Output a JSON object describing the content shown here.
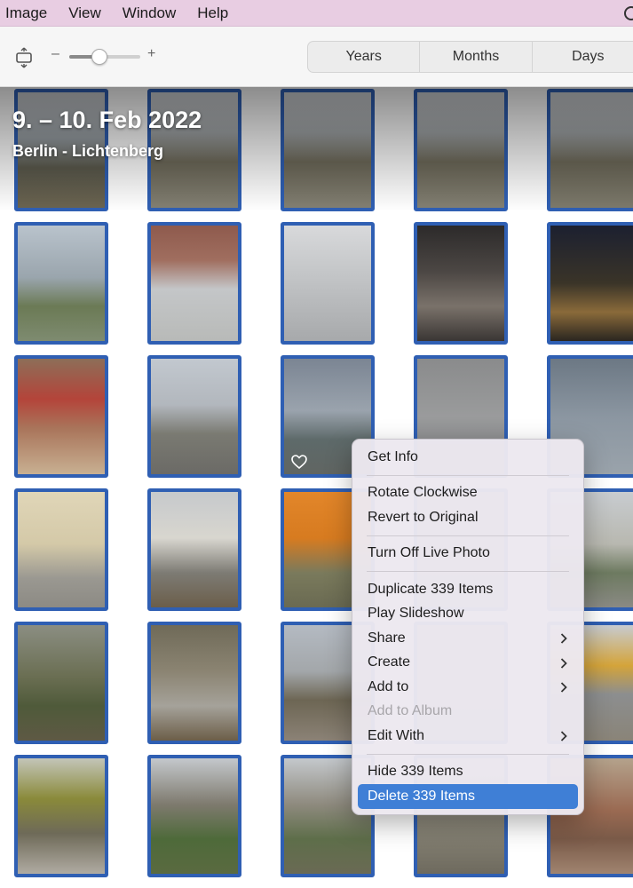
{
  "menubar": {
    "items": [
      "Image",
      "View",
      "Window",
      "Help"
    ]
  },
  "toolbar": {
    "zoom_minus": "–",
    "zoom_plus": "+",
    "zoom_level": 0.42,
    "segments": [
      "Years",
      "Months",
      "Days"
    ]
  },
  "moment": {
    "date_title": "9. – 10. Feb 2022",
    "location": "Berlin - Lichtenberg"
  },
  "accent_color": "#2f5fb3",
  "context_menu": {
    "items": [
      {
        "label": "Get Info",
        "enabled": true
      },
      {
        "label": "Rotate Clockwise",
        "enabled": true
      },
      {
        "label": "Revert to Original",
        "enabled": true
      },
      {
        "label": "Turn Off Live Photo",
        "enabled": true
      },
      {
        "label": "Duplicate 339 Items",
        "enabled": true
      },
      {
        "label": "Play Slideshow",
        "enabled": true
      },
      {
        "label": "Share",
        "enabled": true,
        "submenu": true
      },
      {
        "label": "Create",
        "enabled": true,
        "submenu": true
      },
      {
        "label": "Add to",
        "enabled": true,
        "submenu": true
      },
      {
        "label": "Add to Album",
        "enabled": false
      },
      {
        "label": "Edit With",
        "enabled": true,
        "submenu": true
      },
      {
        "label": "Hide 339 Items",
        "enabled": true
      },
      {
        "label": "Delete 339 Items",
        "enabled": true,
        "highlighted": true
      }
    ],
    "highlight_color": "#3f7fd6"
  },
  "photos": [
    {
      "name": "horse-field",
      "bg": "linear-gradient(180deg,#c9ccd0 0%,#9aa1a6 40%,#5b5a4d 65%,#6b6450 100%)"
    },
    {
      "name": "horses-path",
      "bg": "linear-gradient(180deg,#cfd2d6 0%,#a5a9ab 35%,#6e6a5a 60%,#838073 100%)"
    },
    {
      "name": "horses-path-2",
      "bg": "linear-gradient(180deg,#cfd2d6 0%,#a5a9ab 35%,#6e6a5a 60%,#838073 100%)"
    },
    {
      "name": "horses-path-3",
      "bg": "linear-gradient(180deg,#cfd2d6 0%,#a5a9ab 35%,#6e6a5a 60%,#838073 100%)"
    },
    {
      "name": "horses-path-4",
      "bg": "linear-gradient(180deg,#cfd2d6 0%,#a5a9ab 35%,#6e6a5a 60%,#7d7a6c 100%)"
    },
    {
      "name": "street-sign",
      "bg": "linear-gradient(180deg,#b9c3cc 0%,#9aa5ad 45%,#6b7a55 70%,#7e8b70 100%)"
    },
    {
      "name": "covered-bikes",
      "bg": "linear-gradient(180deg,#8e5a4d 0%,#a06e5f 30%,#c4c6c8 55%,#b8bab8 100%)"
    },
    {
      "name": "snow-pavement",
      "bg": "linear-gradient(180deg,#d8d9db 0%,#c2c4c6 45%,#a7a9ab 100%)"
    },
    {
      "name": "projector-room",
      "bg": "linear-gradient(180deg,#2c2a2a 0%,#4c4744 40%,#7a726a 70%,#3a3634 100%)"
    },
    {
      "name": "night-street",
      "bg": "linear-gradient(180deg,#1c2030 0%,#3a3428 50%,#8a6a3a 75%,#2a2620 100%)"
    },
    {
      "name": "bookshelf",
      "bg": "linear-gradient(180deg,#8d6e58 0%,#b4443a 35%,#a9745a 60%,#c8b092 100%)"
    },
    {
      "name": "road-building",
      "bg": "linear-gradient(180deg,#c2c8cf 0%,#b2b7bd 40%,#7a7a72 65%,#6b6a66 100%)"
    },
    {
      "name": "shop-parking",
      "bg": "linear-gradient(180deg,#7b8593 0%,#9aa3ad 45%,#5e6a6a 70%,#606562 100%)"
    },
    {
      "name": "pavement-sticker",
      "bg": "linear-gradient(180deg,#8a8b8c 0%,#9a9b9c 50%,#7d7e80 100%)"
    },
    {
      "name": "chimney",
      "bg": "linear-gradient(180deg,#6c7884 0%,#8b96a1 50%,#9aa3ab 100%)"
    },
    {
      "name": "building-door",
      "bg": "linear-gradient(180deg,#e0d6b8 0%,#d4c9a8 45%,#9a9891 75%,#8c8a84 100%)"
    },
    {
      "name": "apartment-block",
      "bg": "linear-gradient(180deg,#c6c9cc 0%,#d8d6cf 40%,#7d7b74 70%,#6b5e4a 100%)"
    },
    {
      "name": "orange-wall",
      "bg": "linear-gradient(180deg,#e2862a 0%,#d77b20 40%,#7a7a5c 70%,#6a6a52 100%)"
    },
    {
      "name": "hidden-1",
      "bg": "linear-gradient(180deg,#9aa0a5 0%,#8a8f92 100%)"
    },
    {
      "name": "bike-yard",
      "bg": "linear-gradient(180deg,#c8ccd0 0%,#b8b8b0 45%,#6d7a60 70%,#8a8a84 100%)"
    },
    {
      "name": "tree-trunk",
      "bg": "linear-gradient(180deg,#8b8e82 0%,#6a6e52 45%,#4f5a3a 70%,#5e5944 100%)"
    },
    {
      "name": "path-sign",
      "bg": "linear-gradient(180deg,#6f6a58 0%,#8b8472 40%,#a5a29a 70%,#6c5e48 100%)"
    },
    {
      "name": "playground-path",
      "bg": "linear-gradient(180deg,#b4bac2 0%,#a3a7aa 40%,#6d6654 65%,#8b8276 100%)"
    },
    {
      "name": "hidden-2",
      "bg": "linear-gradient(180deg,#9aa0a5 0%,#8a8f92 100%)"
    },
    {
      "name": "colorful-building",
      "bg": "linear-gradient(180deg,#c7cbd0 0%,#d4a43a 35%,#8c8e8f 60%,#8a8478 100%)"
    },
    {
      "name": "garden-gate",
      "bg": "linear-gradient(180deg,#c3c5b8 0%,#8a8a3a 35%,#6e6a58 65%,#b0aba2 100%)"
    },
    {
      "name": "greenhouse",
      "bg": "linear-gradient(180deg,#c4c8cc 0%,#7e7a6e 40%,#4e6a3a 70%,#5a6a40 100%)"
    },
    {
      "name": "greenhouse-2",
      "bg": "linear-gradient(180deg,#c4c8cc 0%,#8e8a7e 40%,#5e6e4a 70%,#6a6a54 100%)"
    },
    {
      "name": "garden-path",
      "bg": "linear-gradient(180deg,#b8bcc0 0%,#8e8a7c 50%,#6e6a5e 100%)"
    },
    {
      "name": "cemetery",
      "bg": "linear-gradient(180deg,#b4a28c 0%,#9a6a52 45%,#7a5a48 70%,#a08470 100%)"
    }
  ]
}
